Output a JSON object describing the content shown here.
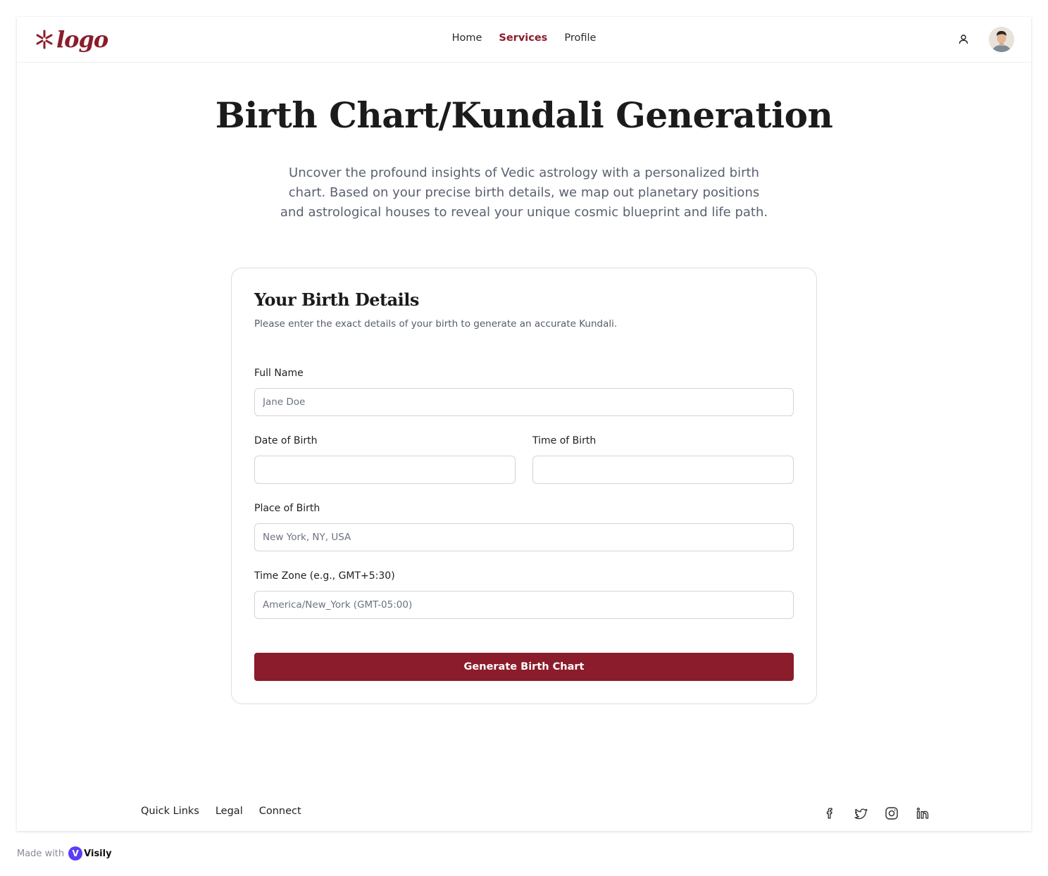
{
  "header": {
    "logo_text": "logo",
    "nav": [
      {
        "label": "Home",
        "active": false
      },
      {
        "label": "Services",
        "active": true
      },
      {
        "label": "Profile",
        "active": false
      }
    ],
    "user_icon": "user-icon",
    "avatar": "user-avatar"
  },
  "hero": {
    "title": "Birth Chart/Kundali Generation",
    "description": "Uncover the profound insights of Vedic astrology with a personalized birth chart. Based on your precise birth details, we map out planetary positions and astrological houses to reveal your unique cosmic blueprint and life path."
  },
  "form": {
    "title": "Your Birth Details",
    "subtitle": "Please enter the exact details of your birth to generate an accurate Kundali.",
    "full_name": {
      "label": "Full Name",
      "placeholder": "Jane Doe",
      "value": ""
    },
    "date_of_birth": {
      "label": "Date of Birth",
      "value": ""
    },
    "time_of_birth": {
      "label": "Time of Birth",
      "value": ""
    },
    "place_of_birth": {
      "label": "Place of Birth",
      "placeholder": "New York, NY, USA",
      "value": ""
    },
    "time_zone": {
      "label": "Time Zone (e.g., GMT+5:30)",
      "placeholder": "America/New_York (GMT-05:00)",
      "value": ""
    },
    "submit_label": "Generate Birth Chart"
  },
  "footer": {
    "links": [
      "Quick Links",
      "Legal",
      "Connect"
    ],
    "social_icons": [
      "facebook-icon",
      "twitter-icon",
      "instagram-icon",
      "linkedin-icon"
    ]
  },
  "watermark": {
    "made_with": "Made with",
    "brand": "Visily"
  },
  "colors": {
    "accent": "#8b1c2b",
    "text": "#1b1b1b",
    "muted": "#5a6270",
    "border": "#d4d4d4"
  }
}
